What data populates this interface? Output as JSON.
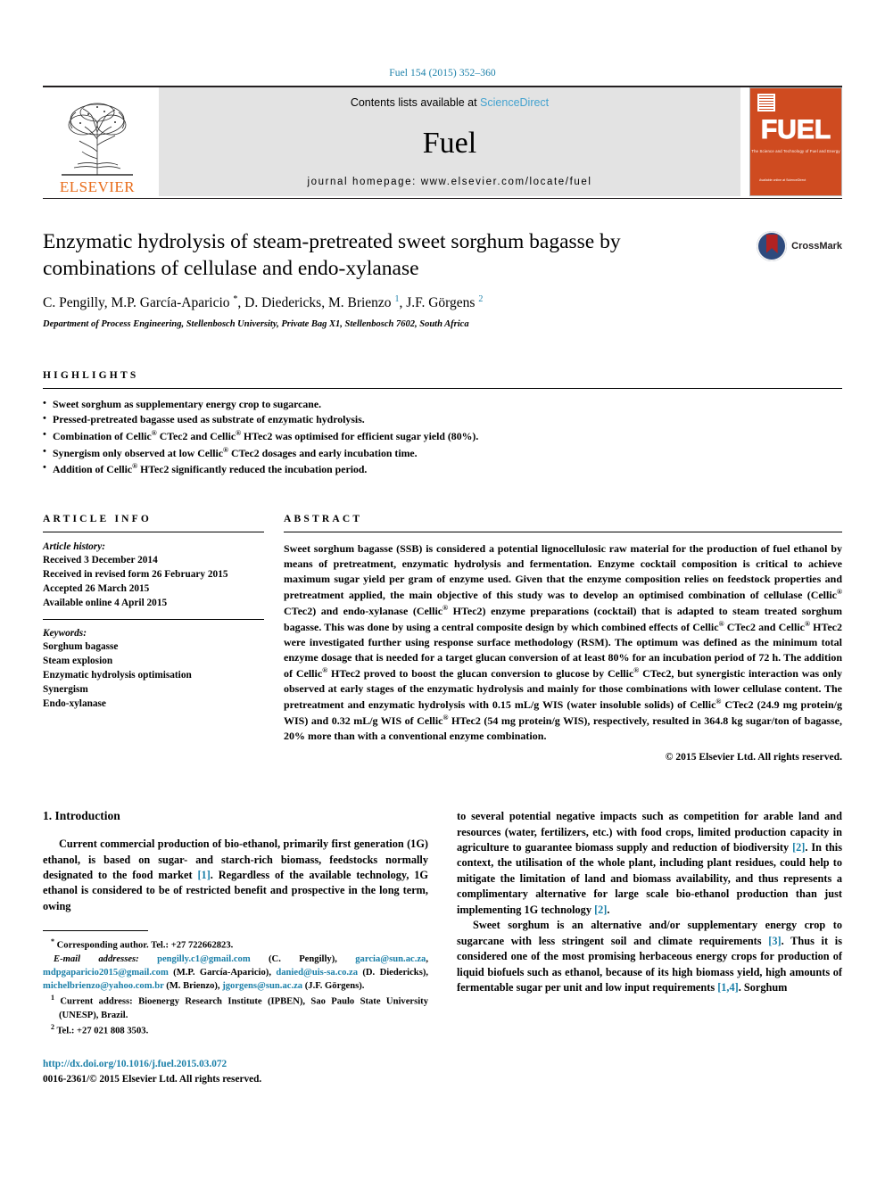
{
  "journal_ref": "Fuel 154 (2015) 352–360",
  "masthead": {
    "publisher": "ELSEVIER",
    "contents_prefix": "Contents lists available at ",
    "contents_link": "ScienceDirect",
    "journal_name": "Fuel",
    "homepage": "journal homepage: www.elsevier.com/locate/fuel",
    "cover_title": "FUEL",
    "cover_subtitle": "The Science and Technology of Fuel and Energy",
    "cover_footer": "Available online at\nScienceDirect"
  },
  "article": {
    "title": "Enzymatic hydrolysis of steam-pretreated sweet sorghum bagasse by combinations of cellulase and endo-xylanase",
    "authors_html": "C. Pengilly, M.P. García-Aparicio <sup class=\"star\">*</sup>, D. Diedericks, M. Brienzo <sup>1</sup>, J.F. Görgens <sup>2</sup>",
    "affiliation": "Department of Process Engineering, Stellenbosch University, Private Bag X1, Stellenbosch 7602, South Africa",
    "crossmark_label": "CrossMark"
  },
  "highlights": {
    "heading": "Highlights",
    "items_html": [
      "Sweet sorghum as supplementary energy crop to sugarcane.",
      "Pressed-pretreated bagasse used as substrate of enzymatic hydrolysis.",
      "Combination of Cellic<span class=\"reg\">®</span> CTec2 and Cellic<span class=\"reg\">®</span> HTec2 was optimised for efficient sugar yield (80%).",
      "Synergism only observed at low Cellic<span class=\"reg\">®</span> CTec2 dosages and early incubation time.",
      "Addition of Cellic<span class=\"reg\">®</span> HTec2 significantly reduced the incubation period."
    ]
  },
  "article_info": {
    "heading": "Article info",
    "history_label": "Article history:",
    "history": [
      "Received 3 December 2014",
      "Received in revised form 26 February 2015",
      "Accepted 26 March 2015",
      "Available online 4 April 2015"
    ],
    "keywords_label": "Keywords:",
    "keywords": [
      "Sorghum bagasse",
      "Steam explosion",
      "Enzymatic hydrolysis optimisation",
      "Synergism",
      "Endo-xylanase"
    ]
  },
  "abstract": {
    "heading": "Abstract",
    "body_html": "Sweet sorghum bagasse (SSB) is considered a potential lignocellulosic raw material for the production of fuel ethanol by means of pretreatment, enzymatic hydrolysis and fermentation. Enzyme cocktail composition is critical to achieve maximum sugar yield per gram of enzyme used. Given that the enzyme composition relies on feedstock properties and pretreatment applied, the main objective of this study was to develop an optimised combination of cellulase (Cellic<span class=\"reg\">®</span> CTec2) and endo-xylanase (Cellic<span class=\"reg\">®</span> HTec2) enzyme preparations (cocktail) that is adapted to steam treated sorghum bagasse. This was done by using a central composite design by which combined effects of Cellic<span class=\"reg\">®</span> CTec2 and Cellic<span class=\"reg\">®</span> HTec2 were investigated further using response surface methodology (RSM). The optimum was defined as the minimum total enzyme dosage that is needed for a target glucan conversion of at least 80% for an incubation period of 72 h. The addition of Cellic<span class=\"reg\">®</span> HTec2 proved to boost the glucan conversion to glucose by Cellic<span class=\"reg\">®</span> CTec2, but synergistic interaction was only observed at early stages of the enzymatic hydrolysis and mainly for those combinations with lower cellulase content. The pretreatment and enzymatic hydrolysis with 0.15 mL/g WIS (water insoluble solids) of Cellic<span class=\"reg\">®</span> CTec2 (24.9 mg protein/g WIS) and 0.32 mL/g WIS of Cellic<span class=\"reg\">®</span> HTec2 (54 mg protein/g WIS), respectively, resulted in 364.8 kg sugar/ton of bagasse, 20% more than with a conventional enzyme combination.",
    "copyright": "© 2015 Elsevier Ltd. All rights reserved."
  },
  "introduction": {
    "section_title": "1. Introduction",
    "left_para_html": "Current commercial production of bio-ethanol, primarily first generation (1G) ethanol, is based on sugar- and starch-rich biomass, feedstocks normally designated to the food market <span class=\"ref\">[1]</span>. Regardless of the available technology, 1G ethanol is considered to be of restricted benefit and prospective in the long term, owing",
    "right_para1_html": "to several potential negative impacts such as competition for arable land and resources (water, fertilizers, etc.) with food crops, limited production capacity in agriculture to guarantee biomass supply and reduction of biodiversity <span class=\"ref\">[2]</span>. In this context, the utilisation of the whole plant, including plant residues, could help to mitigate the limitation of land and biomass availability, and thus represents a complimentary alternative for large scale bio-ethanol production than just implementing 1G technology <span class=\"ref\">[2]</span>.",
    "right_para2_html": "Sweet sorghum is an alternative and/or supplementary energy crop to sugarcane with less stringent soil and climate requirements <span class=\"ref\">[3]</span>. Thus it is considered one of the most promising herbaceous energy crops for production of liquid biofuels such as ethanol, because of its high biomass yield, high amounts of fermentable sugar per unit and low input requirements <span class=\"ref\">[1,4]</span>. Sorghum"
  },
  "footnotes": {
    "corresponding_html": "<sup>*</sup> Corresponding author. Tel.: +27 722662823.",
    "emails_html": "<i>E-mail addresses:</i> <span class=\"link\">pengilly.c1@gmail.com</span> (C. Pengilly), <span class=\"link\">garcia@sun.ac.za</span>, <span class=\"link\">mdpgaparicio2015@gmail.com</span> (M.P. García-Aparicio), <span class=\"link\">danied@uis-sa.co.za</span> (D. Diedericks), <span class=\"link\">michelbrienzo@yahoo.com.br</span> (M. Brienzo), <span class=\"link\">jgorgens@sun.ac.za</span> (J.F. Görgens).",
    "note1_html": "<sup>1</sup> Current address: Bioenergy Research Institute (IPBEN), Sao Paulo State University (UNESP), Brazil.",
    "note2_html": "<sup>2</sup> Tel.: +27 021 808 3503."
  },
  "doi_block": {
    "doi": "http://dx.doi.org/10.1016/j.fuel.2015.03.072",
    "issn_copyright": "0016-2361/© 2015 Elsevier Ltd. All rights reserved."
  }
}
